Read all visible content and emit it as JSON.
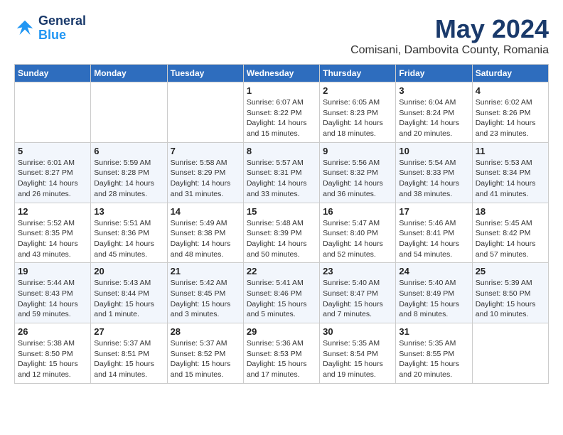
{
  "header": {
    "logo_line1": "General",
    "logo_line2": "Blue",
    "month": "May 2024",
    "location": "Comisani, Dambovita County, Romania"
  },
  "weekdays": [
    "Sunday",
    "Monday",
    "Tuesday",
    "Wednesday",
    "Thursday",
    "Friday",
    "Saturday"
  ],
  "weeks": [
    [
      {
        "day": "",
        "info": ""
      },
      {
        "day": "",
        "info": ""
      },
      {
        "day": "",
        "info": ""
      },
      {
        "day": "1",
        "info": "Sunrise: 6:07 AM\nSunset: 8:22 PM\nDaylight: 14 hours\nand 15 minutes."
      },
      {
        "day": "2",
        "info": "Sunrise: 6:05 AM\nSunset: 8:23 PM\nDaylight: 14 hours\nand 18 minutes."
      },
      {
        "day": "3",
        "info": "Sunrise: 6:04 AM\nSunset: 8:24 PM\nDaylight: 14 hours\nand 20 minutes."
      },
      {
        "day": "4",
        "info": "Sunrise: 6:02 AM\nSunset: 8:26 PM\nDaylight: 14 hours\nand 23 minutes."
      }
    ],
    [
      {
        "day": "5",
        "info": "Sunrise: 6:01 AM\nSunset: 8:27 PM\nDaylight: 14 hours\nand 26 minutes."
      },
      {
        "day": "6",
        "info": "Sunrise: 5:59 AM\nSunset: 8:28 PM\nDaylight: 14 hours\nand 28 minutes."
      },
      {
        "day": "7",
        "info": "Sunrise: 5:58 AM\nSunset: 8:29 PM\nDaylight: 14 hours\nand 31 minutes."
      },
      {
        "day": "8",
        "info": "Sunrise: 5:57 AM\nSunset: 8:31 PM\nDaylight: 14 hours\nand 33 minutes."
      },
      {
        "day": "9",
        "info": "Sunrise: 5:56 AM\nSunset: 8:32 PM\nDaylight: 14 hours\nand 36 minutes."
      },
      {
        "day": "10",
        "info": "Sunrise: 5:54 AM\nSunset: 8:33 PM\nDaylight: 14 hours\nand 38 minutes."
      },
      {
        "day": "11",
        "info": "Sunrise: 5:53 AM\nSunset: 8:34 PM\nDaylight: 14 hours\nand 41 minutes."
      }
    ],
    [
      {
        "day": "12",
        "info": "Sunrise: 5:52 AM\nSunset: 8:35 PM\nDaylight: 14 hours\nand 43 minutes."
      },
      {
        "day": "13",
        "info": "Sunrise: 5:51 AM\nSunset: 8:36 PM\nDaylight: 14 hours\nand 45 minutes."
      },
      {
        "day": "14",
        "info": "Sunrise: 5:49 AM\nSunset: 8:38 PM\nDaylight: 14 hours\nand 48 minutes."
      },
      {
        "day": "15",
        "info": "Sunrise: 5:48 AM\nSunset: 8:39 PM\nDaylight: 14 hours\nand 50 minutes."
      },
      {
        "day": "16",
        "info": "Sunrise: 5:47 AM\nSunset: 8:40 PM\nDaylight: 14 hours\nand 52 minutes."
      },
      {
        "day": "17",
        "info": "Sunrise: 5:46 AM\nSunset: 8:41 PM\nDaylight: 14 hours\nand 54 minutes."
      },
      {
        "day": "18",
        "info": "Sunrise: 5:45 AM\nSunset: 8:42 PM\nDaylight: 14 hours\nand 57 minutes."
      }
    ],
    [
      {
        "day": "19",
        "info": "Sunrise: 5:44 AM\nSunset: 8:43 PM\nDaylight: 14 hours\nand 59 minutes."
      },
      {
        "day": "20",
        "info": "Sunrise: 5:43 AM\nSunset: 8:44 PM\nDaylight: 15 hours\nand 1 minute."
      },
      {
        "day": "21",
        "info": "Sunrise: 5:42 AM\nSunset: 8:45 PM\nDaylight: 15 hours\nand 3 minutes."
      },
      {
        "day": "22",
        "info": "Sunrise: 5:41 AM\nSunset: 8:46 PM\nDaylight: 15 hours\nand 5 minutes."
      },
      {
        "day": "23",
        "info": "Sunrise: 5:40 AM\nSunset: 8:47 PM\nDaylight: 15 hours\nand 7 minutes."
      },
      {
        "day": "24",
        "info": "Sunrise: 5:40 AM\nSunset: 8:49 PM\nDaylight: 15 hours\nand 8 minutes."
      },
      {
        "day": "25",
        "info": "Sunrise: 5:39 AM\nSunset: 8:50 PM\nDaylight: 15 hours\nand 10 minutes."
      }
    ],
    [
      {
        "day": "26",
        "info": "Sunrise: 5:38 AM\nSunset: 8:50 PM\nDaylight: 15 hours\nand 12 minutes."
      },
      {
        "day": "27",
        "info": "Sunrise: 5:37 AM\nSunset: 8:51 PM\nDaylight: 15 hours\nand 14 minutes."
      },
      {
        "day": "28",
        "info": "Sunrise: 5:37 AM\nSunset: 8:52 PM\nDaylight: 15 hours\nand 15 minutes."
      },
      {
        "day": "29",
        "info": "Sunrise: 5:36 AM\nSunset: 8:53 PM\nDaylight: 15 hours\nand 17 minutes."
      },
      {
        "day": "30",
        "info": "Sunrise: 5:35 AM\nSunset: 8:54 PM\nDaylight: 15 hours\nand 19 minutes."
      },
      {
        "day": "31",
        "info": "Sunrise: 5:35 AM\nSunset: 8:55 PM\nDaylight: 15 hours\nand 20 minutes."
      },
      {
        "day": "",
        "info": ""
      }
    ]
  ]
}
